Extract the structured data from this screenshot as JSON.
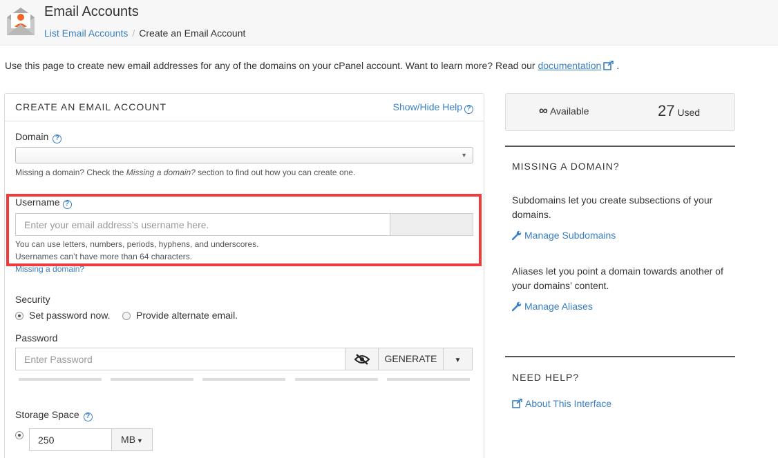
{
  "header": {
    "title": "Email Accounts",
    "breadcrumb_link": "List Email Accounts",
    "breadcrumb_sep": "/",
    "breadcrumb_current": "Create an Email Account"
  },
  "intro": {
    "text": "Use this page to create new email addresses for any of the domains on your cPanel account. Want to learn more? Read our ",
    "link": "documentation",
    "tail": "."
  },
  "form": {
    "title": "CREATE AN EMAIL ACCOUNT",
    "help_toggle": "Show/Hide Help",
    "domain_label": "Domain",
    "domain_value": "",
    "domain_hint_pre": "Missing a domain? Check the ",
    "domain_hint_em": "Missing a domain?",
    "domain_hint_post": " section to find out how you can create one.",
    "username_label": "Username",
    "username_placeholder": "Enter your email address’s username here.",
    "username_hint_1": "You can use letters, numbers, periods, hyphens, and underscores.",
    "username_hint_2": "Usernames can’t have more than 64 characters.",
    "missing_domain_link": "Missing a domain?",
    "security_label": "Security",
    "security_option_1": "Set password now.",
    "security_option_2": "Provide alternate email.",
    "password_label": "Password",
    "password_placeholder": "Enter Password",
    "generate_label": "GENERATE",
    "storage_label": "Storage Space",
    "storage_value": "250",
    "storage_unit": "MB"
  },
  "stats": {
    "available_symbol": "∞",
    "available_label": "Available",
    "used_count": "27",
    "used_label": "Used"
  },
  "sidebar": {
    "missing_heading": "MISSING A DOMAIN?",
    "subdomains_text": "Subdomains let you create subsections of your domains.",
    "subdomains_link": "Manage Subdomains",
    "aliases_text": "Aliases let you point a domain towards another of your domains’ content.",
    "aliases_link": "Manage Aliases",
    "help_heading": "NEED HELP?",
    "about_link": "About This Interface"
  },
  "colors": {
    "link": "#3a7fc2",
    "highlight_box": "#ee3b3b",
    "brand_orange": "#f26522"
  }
}
